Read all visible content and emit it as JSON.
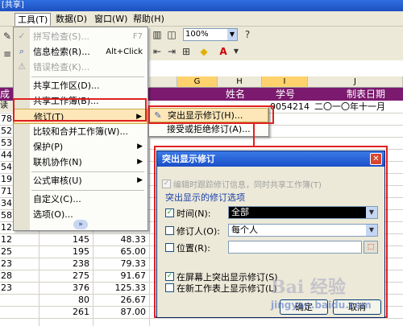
{
  "titlebar": {
    "title": "[共享]"
  },
  "menubar": {
    "items": [
      {
        "label": "工具(T)",
        "active": true
      },
      {
        "label": "数据(D)"
      },
      {
        "label": "窗口(W)"
      },
      {
        "label": "帮助(H)"
      }
    ]
  },
  "toolbar": {
    "zoom": "100%"
  },
  "sheet": {
    "columns": [
      "D",
      "G",
      "H",
      "I",
      "J"
    ],
    "header_row": {
      "name": "姓名",
      "number": "学号",
      "date": "制表日期"
    },
    "row2": {
      "id": "0054214",
      "date": "二〇一〇年十一月"
    },
    "left_fragments": [
      "成",
      "读"
    ],
    "row_labels": [
      "78",
      "52",
      "53",
      "44",
      "54",
      "19",
      "71",
      "34",
      "58",
      "12",
      "12",
      "25",
      "23",
      "28",
      "23"
    ],
    "data_rows": [
      {
        "b": "145",
        "c": "48.33"
      },
      {
        "b": "195",
        "c": "65.00"
      },
      {
        "b": "238",
        "c": "79.33"
      },
      {
        "b": "275",
        "c": "91.67"
      },
      {
        "b": "376",
        "c": "125.33"
      },
      {
        "b": "80",
        "c": "26.67"
      },
      {
        "b": "261",
        "c": "87.00"
      }
    ]
  },
  "tools_menu": {
    "items": [
      {
        "label": "拼写检查(S)...",
        "shortcut": "F7",
        "disabled": true
      },
      {
        "label": "信息检索(R)...",
        "shortcut": "Alt+Click"
      },
      {
        "label": "错误检查(K)...",
        "disabled": true
      },
      {
        "label": "共享工作区(D)..."
      },
      {
        "label": "共享工作簿(B)..."
      },
      {
        "label": "修订(T)",
        "submenu": true
      },
      {
        "label": "比较和合并工作簿(W)..."
      },
      {
        "label": "保护(P)",
        "submenu": true
      },
      {
        "label": "联机协作(N)",
        "submenu": true
      },
      {
        "label": "公式审核(U)",
        "submenu": true
      },
      {
        "label": "自定义(C)..."
      },
      {
        "label": "选项(O)..."
      }
    ],
    "more": "»"
  },
  "revision_submenu": {
    "items": [
      {
        "label": "突出显示修订(H)..."
      },
      {
        "label": "接受或拒绝修订(A)..."
      }
    ]
  },
  "dialog": {
    "title": "突出显示修订",
    "close": "✕",
    "track_label": "编辑时跟踪修订信息，同时共享工作簿(T)",
    "section": "突出显示的修订选项",
    "time_label": "时间(N):",
    "time_value": "全部",
    "reviser_label": "修订人(O):",
    "reviser_value": "每个人",
    "location_label": "位置(R):",
    "location_value": "",
    "screen_label": "在屏幕上突出显示修订(S)",
    "newsheet_label": "在新工作表上显示修订(L)",
    "ok": "确定",
    "cancel": "取消"
  },
  "watermark": {
    "text": "Bai 经验",
    "sub": "jingyan.baidu.com"
  }
}
